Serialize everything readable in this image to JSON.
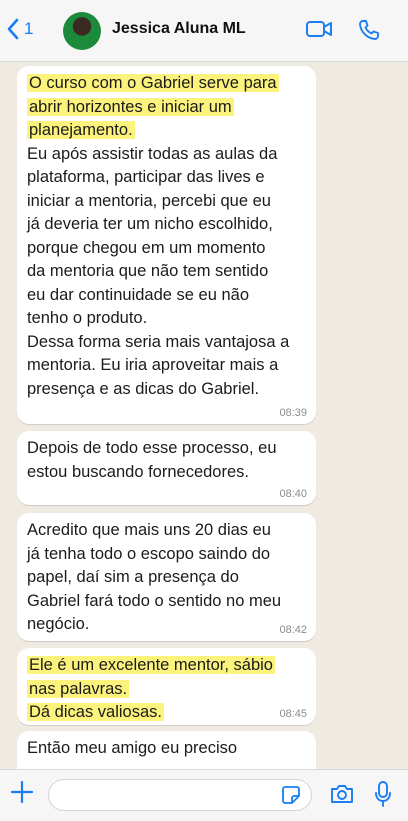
{
  "header": {
    "back_count": "1",
    "contact_name": "Jessica Aluna ML",
    "icons": [
      "chevron-left-icon",
      "video-call-icon",
      "phone-call-icon"
    ]
  },
  "messages": [
    {
      "highlighted": "O curso com o Gabriel serve para\nabrir horizontes e iniciar um\nplanejamento.",
      "text": "Eu após assistir todas as aulas da\nplataforma, participar das lives e\niniciar a mentoria, percebi que eu\njá deveria ter um nicho escolhido,\nporque chegou em um momento\nda mentoria que não tem sentido\neu dar continuidade se eu não\ntenho o produto.\nDessa forma seria mais vantajosa a\nmentoria. Eu iria aproveitar mais a\npresença e as dicas do Gabriel.",
      "time": "08:39"
    },
    {
      "text": "Depois de todo esse processo, eu\nestou buscando fornecedores.",
      "time": "08:40"
    },
    {
      "text": "Acredito que mais uns 20 dias eu\njá tenha todo o escopo saindo do\npapel, daí sim a presença do\nGabriel fará todo o sentido no meu\nnegócio.",
      "time": "08:42"
    },
    {
      "highlighted": "Ele é um excelente mentor, sábio\nnas palavras.\nDá dicas valiosas.",
      "time": "08:45"
    },
    {
      "text": "Então meu amigo eu preciso"
    }
  ],
  "input_bar": {
    "placeholder": "",
    "icons": [
      "plus-icon",
      "sticker-icon",
      "camera-icon",
      "microphone-icon"
    ]
  },
  "colors": {
    "accent": "#1a7ef2",
    "highlight": "#fbf37c",
    "bubble": "#ffffff",
    "chat_background": "#efeae2"
  }
}
